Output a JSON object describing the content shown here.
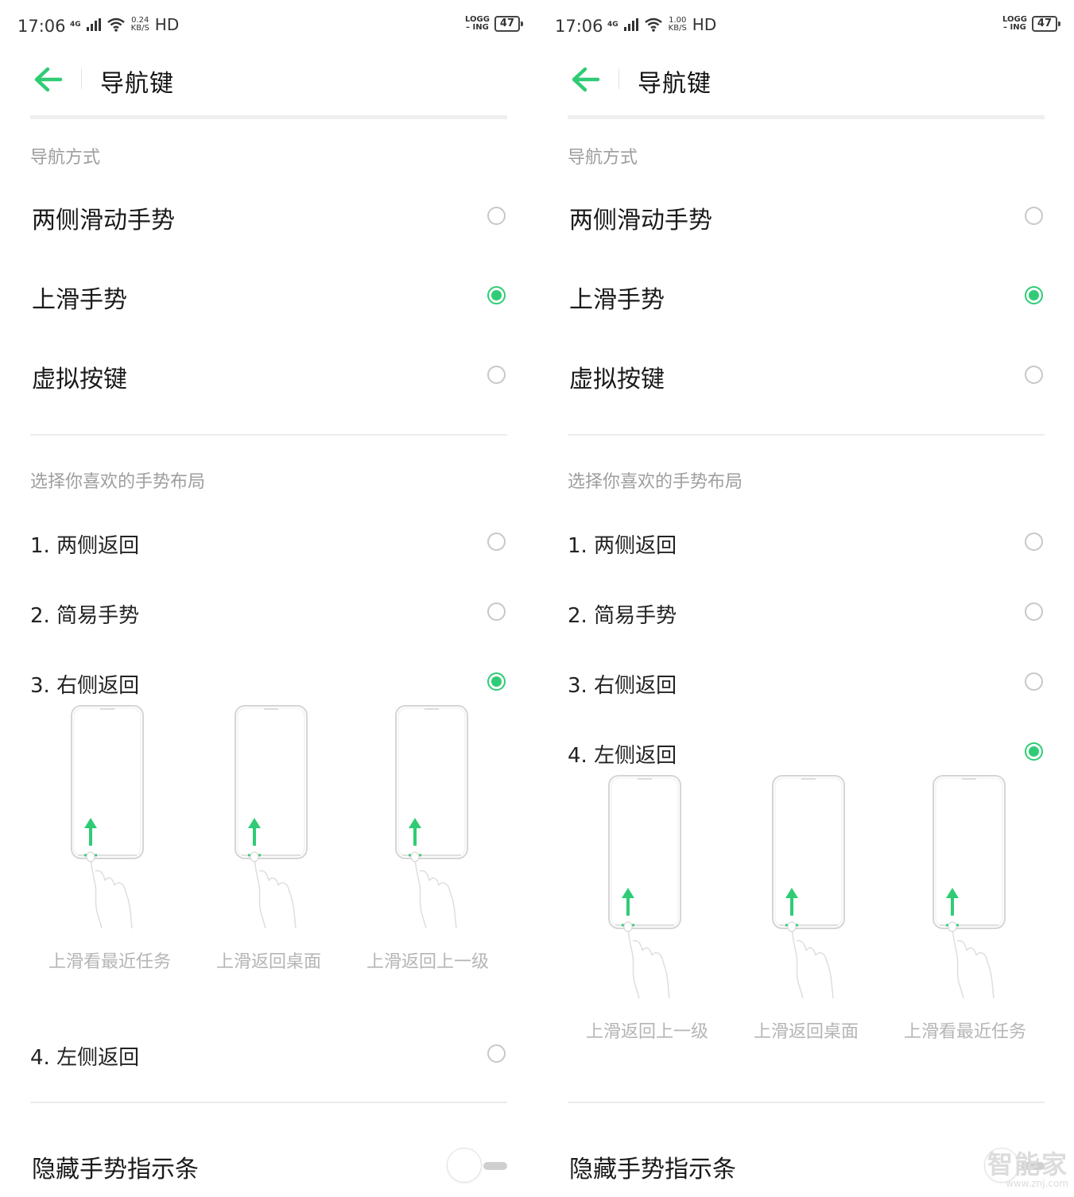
{
  "accent_color": "#2fcc75",
  "watermark": {
    "brand": "智能家",
    "url": "www.znj.com"
  },
  "panels": [
    {
      "status": {
        "time": "17:06",
        "network": "4G",
        "speed_value": "0.24",
        "speed_unit": "KB/S",
        "hd": "HD",
        "logging_top": "LOGG",
        "logging_bottom": "ING",
        "battery": "47"
      },
      "header": {
        "back_icon": "arrow-left-icon",
        "title": "导航键"
      },
      "nav_mode": {
        "section_label": "导航方式",
        "options": [
          {
            "label": "两侧滑动手势",
            "selected": false
          },
          {
            "label": "上滑手势",
            "selected": true
          },
          {
            "label": "虚拟按键",
            "selected": false
          }
        ]
      },
      "layout": {
        "section_label": "选择你喜欢的手势布局",
        "options": [
          {
            "label": "1. 两侧返回",
            "selected": false
          },
          {
            "label": "2. 简易手势",
            "selected": false
          },
          {
            "label": "3. 右侧返回",
            "selected": true
          },
          {
            "label": "4. 左侧返回",
            "selected": false
          }
        ],
        "captions": [
          "上滑看最近任务",
          "上滑返回桌面",
          "上滑返回上一级"
        ]
      },
      "hide_bar": {
        "label": "隐藏手势指示条",
        "enabled": false
      }
    },
    {
      "status": {
        "time": "17:06",
        "network": "4G",
        "speed_value": "1.00",
        "speed_unit": "KB/S",
        "hd": "HD",
        "logging_top": "LOGG",
        "logging_bottom": "ING",
        "battery": "47"
      },
      "header": {
        "back_icon": "arrow-left-icon",
        "title": "导航键"
      },
      "nav_mode": {
        "section_label": "导航方式",
        "options": [
          {
            "label": "两侧滑动手势",
            "selected": false
          },
          {
            "label": "上滑手势",
            "selected": true
          },
          {
            "label": "虚拟按键",
            "selected": false
          }
        ]
      },
      "layout": {
        "section_label": "选择你喜欢的手势布局",
        "options": [
          {
            "label": "1. 两侧返回",
            "selected": false
          },
          {
            "label": "2. 简易手势",
            "selected": false
          },
          {
            "label": "3. 右侧返回",
            "selected": false
          },
          {
            "label": "4. 左侧返回",
            "selected": true
          }
        ],
        "captions": [
          "上滑返回上一级",
          "上滑返回桌面",
          "上滑看最近任务"
        ]
      },
      "hide_bar": {
        "label": "隐藏手势指示条",
        "enabled": false
      }
    }
  ]
}
